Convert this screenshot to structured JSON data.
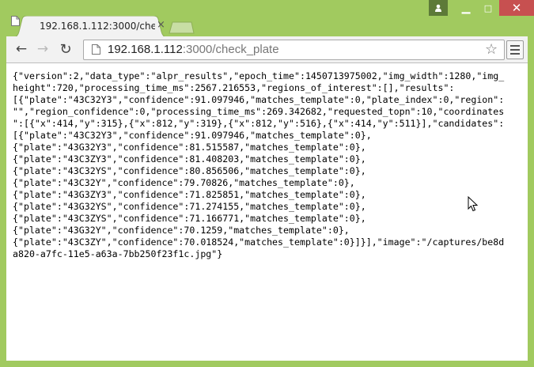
{
  "window": {
    "controls": {
      "minimize": "▁",
      "maximize": "□",
      "close": "✕"
    }
  },
  "tab": {
    "title": "192.168.1.112:3000/check_",
    "close": "×"
  },
  "toolbar": {
    "back": "←",
    "forward": "→",
    "reload": "↻",
    "url_host": "192.168.1.112",
    "url_path": ":3000/check_plate",
    "star": "☆"
  },
  "content": {
    "lines": [
      "{\"version\":2,\"data_type\":\"alpr_results\",\"epoch_time\":1450713975002,\"img_width\":1280,\"img_",
      "height\":720,\"processing_time_ms\":2567.216553,\"regions_of_interest\":[],\"results\":",
      "[{\"plate\":\"43C32Y3\",\"confidence\":91.097946,\"matches_template\":0,\"plate_index\":0,\"region\":",
      "\"\",\"region_confidence\":0,\"processing_time_ms\":269.342682,\"requested_topn\":10,\"coordinates",
      "\":[{\"x\":414,\"y\":315},{\"x\":812,\"y\":319},{\"x\":812,\"y\":516},{\"x\":414,\"y\":511}],\"candidates\":",
      "[{\"plate\":\"43C32Y3\",\"confidence\":91.097946,\"matches_template\":0},",
      "{\"plate\":\"43G32Y3\",\"confidence\":81.515587,\"matches_template\":0},",
      "{\"plate\":\"43C3ZY3\",\"confidence\":81.408203,\"matches_template\":0},",
      "{\"plate\":\"43C32YS\",\"confidence\":80.856506,\"matches_template\":0},",
      "{\"plate\":\"43C32Y\",\"confidence\":79.70826,\"matches_template\":0},",
      "{\"plate\":\"43G3ZY3\",\"confidence\":71.825851,\"matches_template\":0},",
      "{\"plate\":\"43G32YS\",\"confidence\":71.274155,\"matches_template\":0},",
      "{\"plate\":\"43C3ZYS\",\"confidence\":71.166771,\"matches_template\":0},",
      "{\"plate\":\"43G32Y\",\"confidence\":70.1259,\"matches_template\":0},",
      "{\"plate\":\"43C3ZY\",\"confidence\":70.018524,\"matches_template\":0}]}],\"image\":\"/captures/be8d",
      "a820-a7fc-11e5-a63a-7bb250f23f1c.jpg\"}"
    ]
  },
  "colors": {
    "frame": "#a1ca5f",
    "close_button": "#c75050",
    "toolbar": "#f2f2f2"
  },
  "icons": {
    "user": "user-icon",
    "page": "page-icon",
    "star": "star-icon",
    "menu": "hamburger-menu-icon"
  }
}
